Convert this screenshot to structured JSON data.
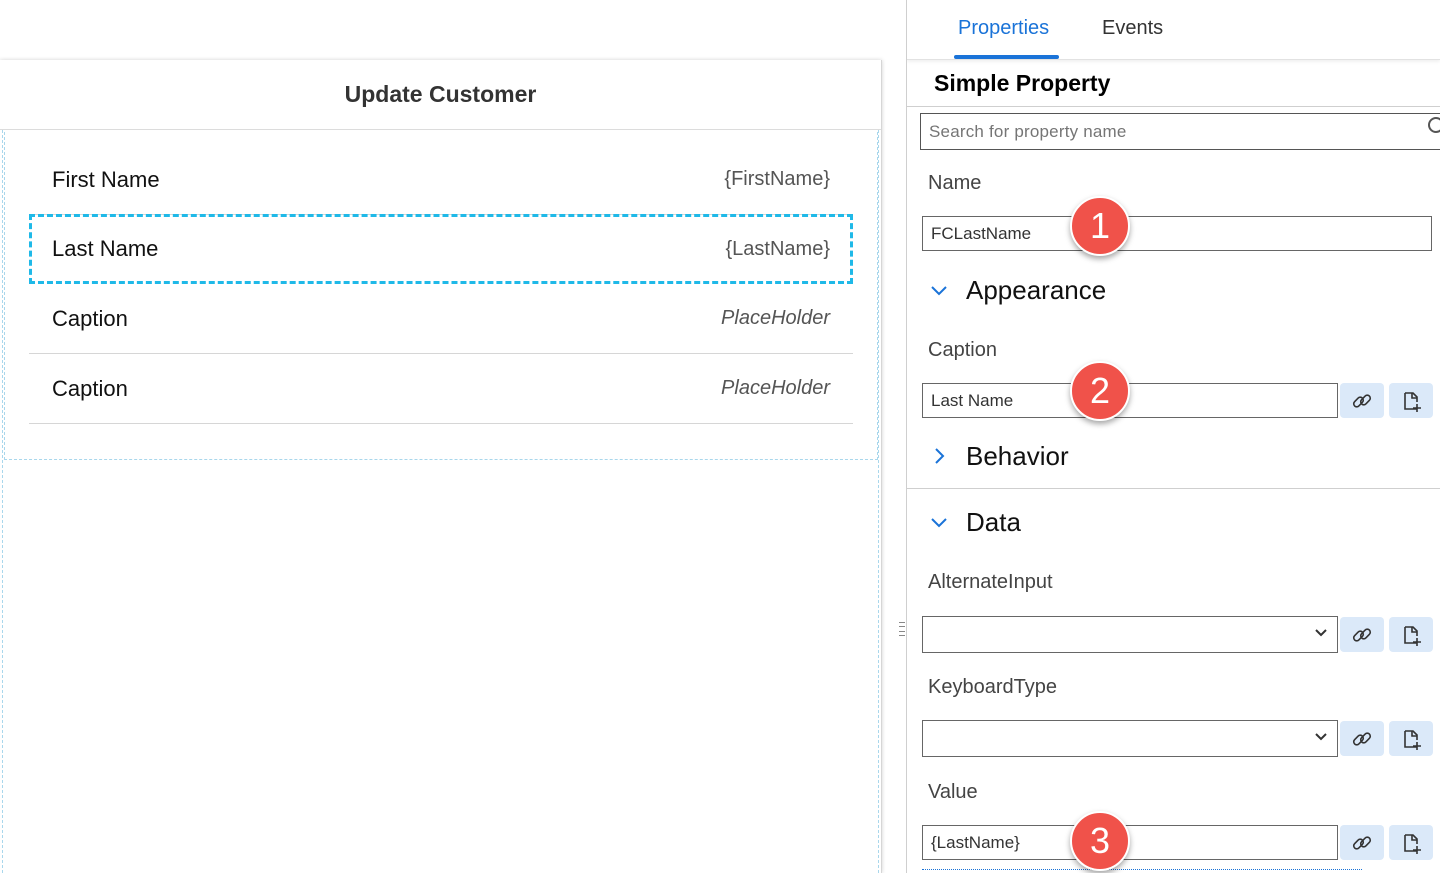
{
  "form": {
    "header": "Update Customer",
    "rows": [
      {
        "label": "First Name",
        "value": "{FirstName}"
      },
      {
        "label": "Last Name",
        "value": "{LastName}"
      },
      {
        "label": "Caption",
        "value": "PlaceHolder"
      },
      {
        "label": "Caption",
        "value": "PlaceHolder"
      }
    ]
  },
  "panel": {
    "tabs": [
      "Properties",
      "Events"
    ],
    "active_tab": "Properties",
    "title": "Simple Property",
    "search_placeholder": "Search for property name",
    "name_label": "Name",
    "name_value": "FCLastName",
    "sections": {
      "appearance": "Appearance",
      "behavior": "Behavior",
      "data": "Data"
    },
    "caption_label": "Caption",
    "caption_value": "Last Name",
    "alternate_input_label": "AlternateInput",
    "alternate_input_value": "",
    "keyboard_type_label": "KeyboardType",
    "keyboard_type_value": "",
    "value_label": "Value",
    "value_value": "{LastName}"
  },
  "badges": [
    "1",
    "2",
    "3"
  ],
  "colors": {
    "accent": "#1a73d8",
    "selection": "#1fb9e8",
    "badge": "#f0524a",
    "icon_button_bg": "#dbe9f9"
  },
  "icons": [
    "search-icon",
    "link-icon",
    "add-binding-icon",
    "chevron-down-icon",
    "chevron-right-icon"
  ]
}
